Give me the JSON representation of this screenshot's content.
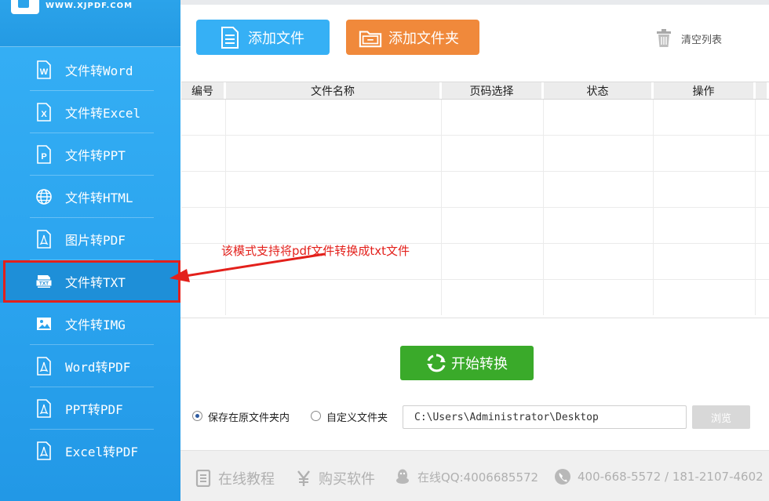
{
  "logo": {
    "url_text": "WWW.XJPDF.COM"
  },
  "sidebar": {
    "items": [
      {
        "label": "文件转Word",
        "icon": "word-doc-icon"
      },
      {
        "label": "文件转Excel",
        "icon": "excel-doc-icon"
      },
      {
        "label": "文件转PPT",
        "icon": "ppt-doc-icon"
      },
      {
        "label": "文件转HTML",
        "icon": "globe-icon"
      },
      {
        "label": "图片转PDF",
        "icon": "pdf-doc-icon"
      },
      {
        "label": "文件转TXT",
        "icon": "txt-doc-icon",
        "active": true
      },
      {
        "label": "文件转IMG",
        "icon": "image-icon"
      },
      {
        "label": "Word转PDF",
        "icon": "pdf-doc-icon"
      },
      {
        "label": "PPT转PDF",
        "icon": "pdf-doc-icon"
      },
      {
        "label": "Excel转PDF",
        "icon": "pdf-doc-icon"
      }
    ]
  },
  "toolbar": {
    "add_file_label": "添加文件",
    "add_folder_label": "添加文件夹",
    "clear_list_label": "清空列表"
  },
  "table": {
    "columns": [
      "编号",
      "文件名称",
      "页码选择",
      "状态",
      "操作"
    ]
  },
  "annotation": {
    "text": "该模式支持将pdf文件转换成txt文件"
  },
  "actions": {
    "start_label": "开始转换"
  },
  "output": {
    "option_original": "保存在原文件夹内",
    "option_custom": "自定义文件夹",
    "selected": "original",
    "path_value": "C:\\Users\\Administrator\\Desktop",
    "browse_label": "浏览"
  },
  "footer": {
    "tutorial_label": "在线教程",
    "buy_label": "购买软件",
    "qq_label": "在线QQ:4006685572",
    "phone_label": "400-668-5572 / 181-2107-4602"
  },
  "colors": {
    "sidebar": "#2aa3ee",
    "add_file": "#36b0f5",
    "add_folder": "#f0893b",
    "start": "#3aaa2a",
    "highlight": "#e3201b"
  }
}
